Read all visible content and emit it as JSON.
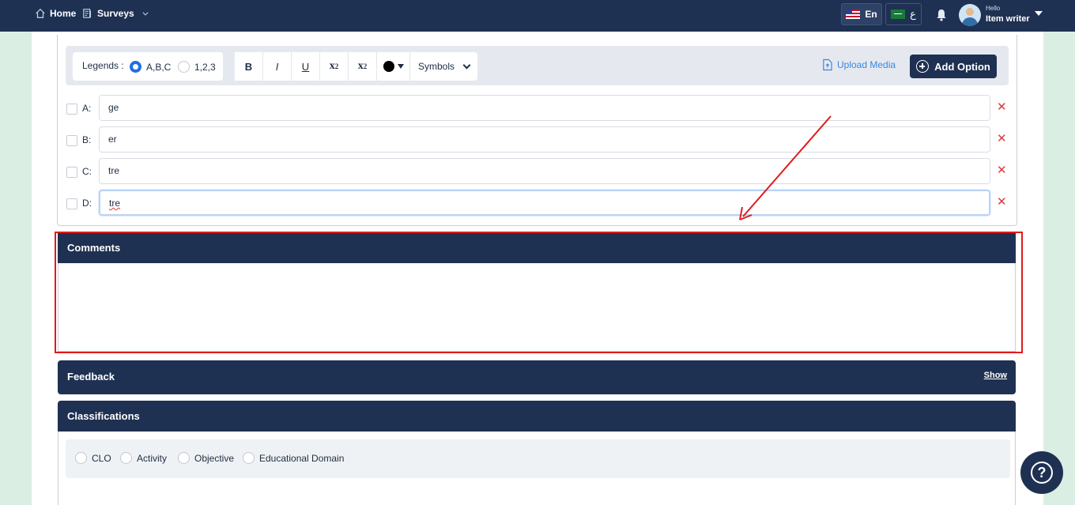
{
  "nav": {
    "home_label": "Home",
    "surveys_label": "Surveys",
    "lang_en_label": "En",
    "lang_ar_label": "ع",
    "user_greeting": "Hello",
    "user_name": "Item writer"
  },
  "toolbar": {
    "legends_label": "Legends :",
    "legend_options": [
      "A,B,C",
      "1,2,3"
    ],
    "legend_selected": "A,B,C",
    "bold": "B",
    "italic": "I",
    "underline": "U",
    "subscript": "x",
    "subscript_sub": "2",
    "superscript": "x",
    "superscript_sup": "2",
    "text_color": "#000000",
    "symbols_label": "Symbols",
    "upload_media_label": "Upload Media",
    "add_option_label": "Add Option"
  },
  "options": [
    {
      "letter": "A:",
      "value": "ge"
    },
    {
      "letter": "B:",
      "value": "er"
    },
    {
      "letter": "C:",
      "value": "tre"
    },
    {
      "letter": "D:",
      "value": "tre"
    }
  ],
  "delete_glyph": "✕",
  "comments": {
    "title": "Comments"
  },
  "feedback": {
    "title": "Feedback",
    "show_label": "Show"
  },
  "classifications": {
    "title": "Classifications",
    "options": [
      "CLO",
      "Activity",
      "Objective",
      "Educational Domain"
    ]
  },
  "help_glyph": "?",
  "colors": {
    "navy": "#1f3152",
    "accent_blue": "#1f6fe0",
    "link_blue": "#3a86e0",
    "delete_red": "#d53b3b",
    "annotation_red": "#e01b1b",
    "background_green": "#dbeee4"
  }
}
